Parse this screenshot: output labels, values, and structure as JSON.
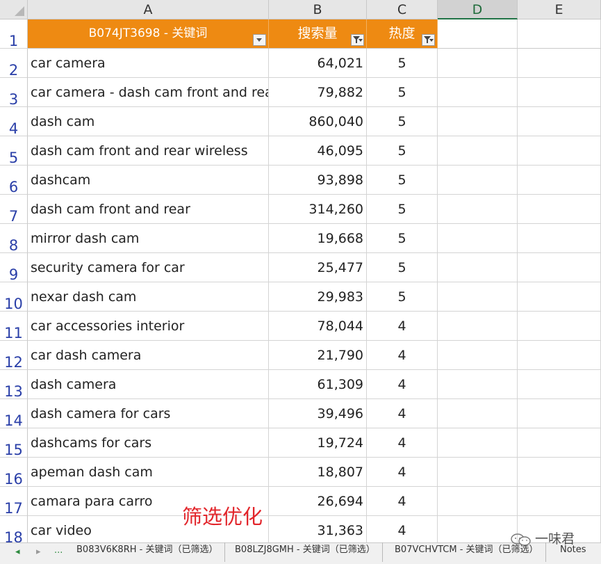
{
  "columns": [
    "A",
    "B",
    "C",
    "D",
    "E"
  ],
  "header": {
    "col_a": "B074JT3698 - 关键词",
    "col_b": "搜索量",
    "col_c": "热度"
  },
  "row_numbers": [
    "1",
    "2",
    "3",
    "4",
    "5",
    "6",
    "7",
    "8",
    "9",
    "10",
    "11",
    "12",
    "13",
    "14",
    "15",
    "16",
    "17",
    "18"
  ],
  "rows": [
    {
      "keyword": "car camera",
      "volume": "64,021",
      "heat": "5"
    },
    {
      "keyword": "car camera - dash cam front and rear",
      "volume": "79,882",
      "heat": "5"
    },
    {
      "keyword": "dash cam",
      "volume": "860,040",
      "heat": "5"
    },
    {
      "keyword": "dash cam front and rear wireless",
      "volume": "46,095",
      "heat": "5"
    },
    {
      "keyword": "dashcam",
      "volume": "93,898",
      "heat": "5"
    },
    {
      "keyword": "dash cam front and rear",
      "volume": "314,260",
      "heat": "5"
    },
    {
      "keyword": "mirror dash cam",
      "volume": "19,668",
      "heat": "5"
    },
    {
      "keyword": "security camera for car",
      "volume": "25,477",
      "heat": "5"
    },
    {
      "keyword": "nexar dash cam",
      "volume": "29,983",
      "heat": "5"
    },
    {
      "keyword": "car accessories interior",
      "volume": "78,044",
      "heat": "4"
    },
    {
      "keyword": "car dash camera",
      "volume": "21,790",
      "heat": "4"
    },
    {
      "keyword": "dash camera",
      "volume": "61,309",
      "heat": "4"
    },
    {
      "keyword": "dash camera for cars",
      "volume": "39,496",
      "heat": "4"
    },
    {
      "keyword": "dashcams for cars",
      "volume": "19,724",
      "heat": "4"
    },
    {
      "keyword": "apeman dash cam",
      "volume": "18,807",
      "heat": "4"
    },
    {
      "keyword": "camara para carro",
      "volume": "26,694",
      "heat": "4"
    },
    {
      "keyword": "car video",
      "volume": "31,363",
      "heat": "4"
    }
  ],
  "overlay_text": "筛选优化",
  "watermark": "一味君",
  "tabs": {
    "nav_prev": "◂",
    "nav_next": "▸",
    "nav_more": "...",
    "items": [
      "B083V6K8RH - 关键词（已筛选）",
      "B08LZJ8GMH - 关键词（已筛选）",
      "B07VCHVTCM - 关键词（已筛选）",
      "Notes"
    ]
  },
  "colors": {
    "header_fill": "#ee8a12",
    "row_number": "#2a3fa8",
    "overlay_text": "#e2252b"
  }
}
